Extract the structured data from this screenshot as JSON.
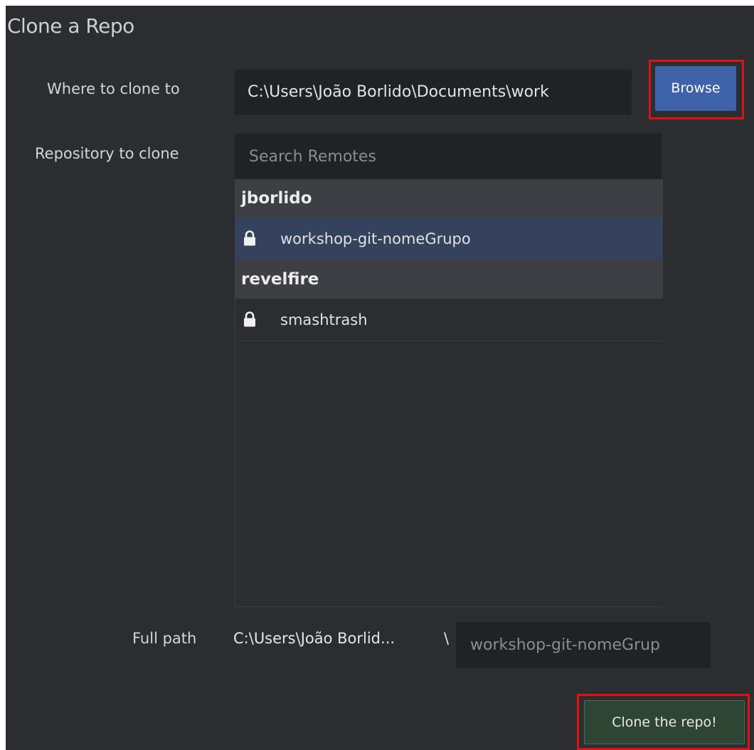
{
  "dialog": {
    "title": "Clone a Repo"
  },
  "destination": {
    "label": "Where to clone to",
    "value": "C:\\Users\\João Borlido\\Documents\\work",
    "browse_label": "Browse"
  },
  "repository": {
    "label": "Repository to clone",
    "search_placeholder": "Search Remotes",
    "groups": [
      {
        "owner": "jborlido",
        "repos": [
          {
            "name": "workshop-git-nomeGrupo",
            "icon": "lock-icon",
            "selected": true
          }
        ]
      },
      {
        "owner": "revelfire",
        "repos": [
          {
            "name": "smashtrash",
            "icon": "lock-icon",
            "selected": false
          }
        ]
      }
    ]
  },
  "full_path": {
    "label": "Full path",
    "prefix": "C:\\Users\\João Borlid...",
    "separator": "\\",
    "name_value": "workshop-git-nomeGrup"
  },
  "actions": {
    "clone_label": "Clone the repo!"
  },
  "colors": {
    "background": "#2b2d31",
    "selected_row": "#34425e",
    "browse_button": "#3e63a9",
    "clone_button": "#2d4532",
    "highlight_outline": "#d91414"
  }
}
